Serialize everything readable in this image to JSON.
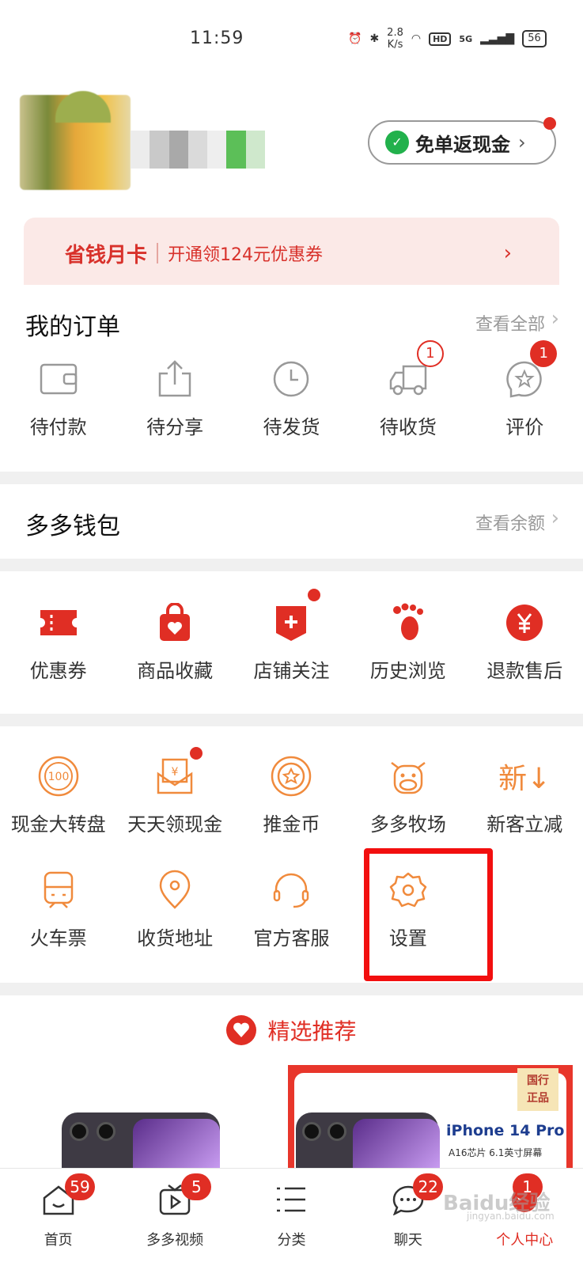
{
  "status_bar": {
    "time": "11:59",
    "net_speed_value": "2.8",
    "net_speed_unit": "K/s",
    "hd": "HD",
    "signal": "5G",
    "battery": "56"
  },
  "header": {
    "cashback_label": "免单返现金",
    "savecard_title": "省钱月卡",
    "savecard_desc": "开通领124元优惠券"
  },
  "orders": {
    "title": "我的订单",
    "link": "查看全部",
    "items": [
      {
        "label": "待付款",
        "icon": "wallet-icon"
      },
      {
        "label": "待分享",
        "icon": "share-icon"
      },
      {
        "label": "待发货",
        "icon": "clock-icon"
      },
      {
        "label": "待收货",
        "icon": "truck-icon",
        "badge": "1"
      },
      {
        "label": "评价",
        "icon": "review-icon",
        "badge": "1"
      }
    ]
  },
  "wallet": {
    "title": "多多钱包",
    "link": "查看余额"
  },
  "shortcuts": [
    {
      "label": "优惠券",
      "icon": "coupon-icon"
    },
    {
      "label": "商品收藏",
      "icon": "favorite-bag-icon"
    },
    {
      "label": "店铺关注",
      "icon": "store-follow-icon"
    },
    {
      "label": "历史浏览",
      "icon": "footprint-icon"
    },
    {
      "label": "退款售后",
      "icon": "refund-icon"
    }
  ],
  "services_row1": [
    {
      "label": "现金大转盘",
      "icon": "wheel-100-icon"
    },
    {
      "label": "天天领现金",
      "icon": "cash-envelope-icon"
    },
    {
      "label": "推金币",
      "icon": "coin-icon"
    },
    {
      "label": "多多牧场",
      "icon": "cow-icon"
    },
    {
      "label": "新客立减",
      "icon": "new-discount-icon",
      "glyph": "新↓"
    }
  ],
  "services_row2": [
    {
      "label": "火车票",
      "icon": "train-icon"
    },
    {
      "label": "收货地址",
      "icon": "location-icon"
    },
    {
      "label": "官方客服",
      "icon": "headset-icon"
    },
    {
      "label": "设置",
      "icon": "gear-icon"
    }
  ],
  "recommend": {
    "title": "精选推荐",
    "product2_title": "iPhone 14 Pro",
    "product2_sub": "A16芯片 6.1英寸屏幕",
    "product2_tag_line1": "国行",
    "product2_tag_line2": "正品"
  },
  "bottom_nav": [
    {
      "label": "首页",
      "badge": "59",
      "icon": "home-icon"
    },
    {
      "label": "多多视频",
      "badge": "5",
      "icon": "video-icon"
    },
    {
      "label": "分类",
      "icon": "category-icon"
    },
    {
      "label": "聊天",
      "badge": "22",
      "icon": "chat-icon"
    },
    {
      "label": "个人中心",
      "badge": "1",
      "icon": "profile-icon",
      "active": true
    }
  ],
  "watermark": {
    "text": "Baidu经验",
    "url": "jingyan.baidu.com"
  },
  "colors": {
    "accent": "#e02e24",
    "orange_icon": "#f08a3c",
    "highlight": "#f20f0f"
  }
}
